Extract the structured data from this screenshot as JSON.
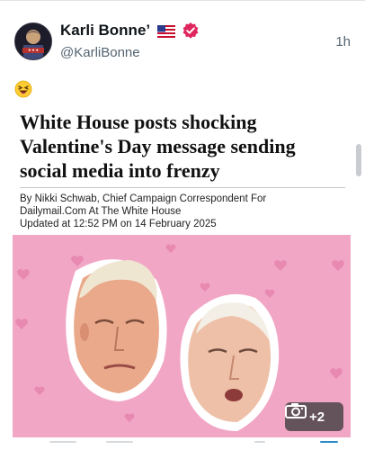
{
  "author": {
    "name": "Karli Bonne’",
    "handle": "@KarliBonne",
    "time": "1h",
    "flag_icon": "us-flag-icon",
    "verified_icon": "verified-badge-icon"
  },
  "post": {
    "emoji": "😆"
  },
  "article": {
    "headline_lines": [
      "White House posts shocking",
      "Valentine's Day message sending",
      "social media into frenzy"
    ],
    "byline_lines": [
      "By Nikki Schwab, Chief Campaign Correspondent For",
      "Dailymail.Com At The White House",
      "Updated at 12:52 PM on 14 February 2025"
    ]
  },
  "media": {
    "extra_count": "+2",
    "icon": "camera-icon",
    "background_color": "#f2a6c6"
  }
}
